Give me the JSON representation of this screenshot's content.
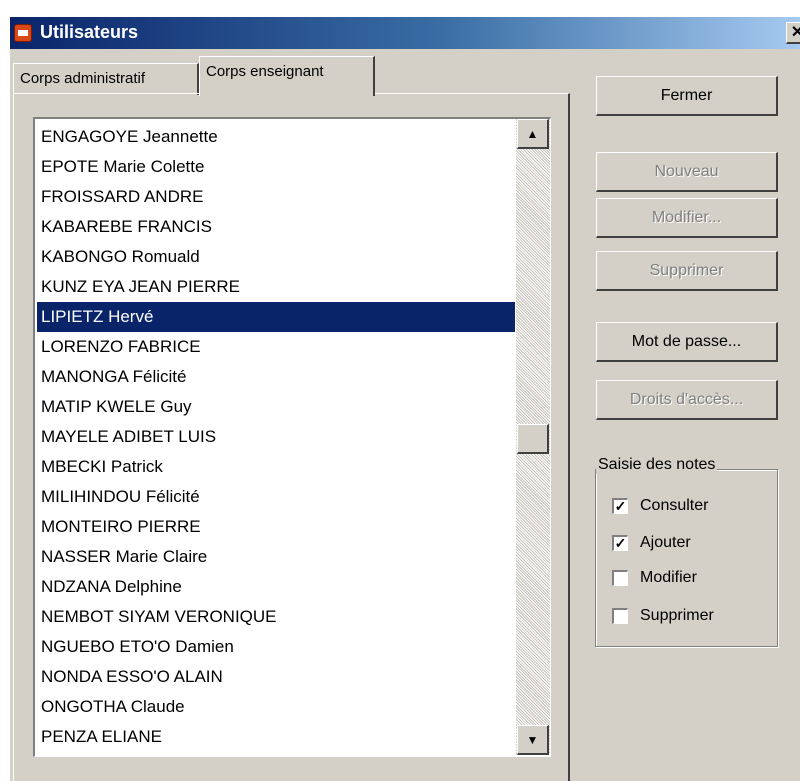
{
  "window": {
    "title": "Utilisateurs",
    "close_symbol": "✕"
  },
  "tabs": [
    {
      "label": "Corps administratif",
      "active": false
    },
    {
      "label": "Corps enseignant",
      "active": true
    }
  ],
  "list": {
    "items": [
      "ENGAGOYE Jeannette",
      "EPOTE Marie Colette",
      "FROISSARD ANDRE",
      "KABAREBE FRANCIS",
      "KABONGO Romuald",
      "KUNZ EYA JEAN PIERRE",
      "LIPIETZ Hervé",
      "LORENZO FABRICE",
      "MANONGA Félicité",
      "MATIP KWELE Guy",
      "MAYELE ADIBET LUIS",
      "MBECKI Patrick",
      "MILIHINDOU Félicité",
      "MONTEIRO PIERRE",
      "NASSER Marie Claire",
      "NDZANA Delphine",
      "NEMBOT SIYAM VERONIQUE",
      "NGUEBO ETO'O Damien",
      "NONDA ESSO'O ALAIN",
      "ONGOTHA Claude",
      "PENZA ELIANE"
    ],
    "selected_index": 6,
    "scroll_up_icon": "▲",
    "scroll_down_icon": "▼"
  },
  "buttons": {
    "fermer": "Fermer",
    "nouveau": "Nouveau",
    "modifier": "Modifier...",
    "supprimer": "Supprimer",
    "mot_de_passe": "Mot de passe...",
    "droits": "Droits d'accès..."
  },
  "saisie": {
    "label": "Saisie des notes",
    "options": [
      {
        "label": "Consulter",
        "checked": true
      },
      {
        "label": "Ajouter",
        "checked": true
      },
      {
        "label": "Modifier",
        "checked": false
      },
      {
        "label": "Supprimer",
        "checked": false
      }
    ]
  },
  "colors": {
    "selection": "#0a246a",
    "face": "#d4d0c8"
  }
}
